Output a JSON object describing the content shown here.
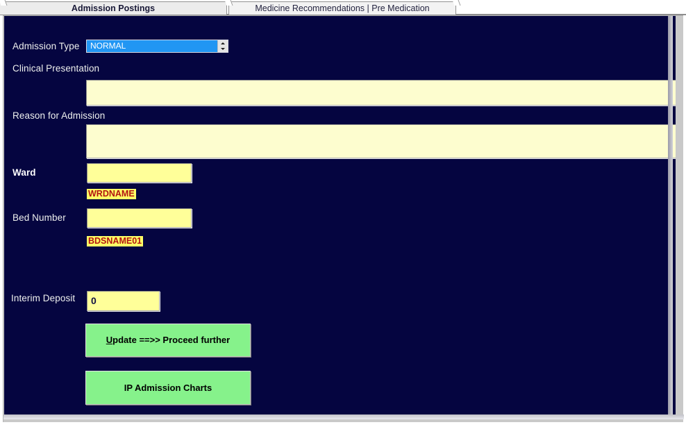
{
  "window": {
    "title": "Admission Postings",
    "background_color": "#050540",
    "accent_color": "#2196f3",
    "button_color": "#86f28b",
    "field_color": "#ffff99",
    "textarea_color": "#fdfdcf",
    "tag_text_color": "#b31412"
  },
  "tabs": [
    {
      "label": "Admission Postings",
      "active": true
    },
    {
      "label": "Medicine Recommendations | Pre Medication",
      "active": false
    }
  ],
  "form": {
    "admission_type": {
      "label": "Admission Type",
      "value": "NORMAL",
      "options": [
        "NORMAL"
      ],
      "spinner_up": "up-arrow-icon",
      "spinner_down": "down-arrow-icon"
    },
    "clinical_presentation": {
      "label": "Clinical Presentation",
      "value": "",
      "placeholder": ""
    },
    "reason_for_admission": {
      "label": "Reason for Admission",
      "value": "",
      "placeholder": ""
    },
    "ward": {
      "label": "Ward",
      "value": "",
      "placeholder": "",
      "tag": "WRDNAME"
    },
    "bed_number": {
      "label": "Bed Number",
      "value": "",
      "placeholder": "",
      "tag": "BDSNAME01"
    },
    "interim_deposit": {
      "label": "Interim Deposit",
      "value": "0",
      "placeholder": ""
    }
  },
  "actions": {
    "update": {
      "accel": "U",
      "rest": "pdate ==>> Proceed further",
      "full_label": "Update ==>> Proceed further"
    },
    "charts": {
      "label": "IP Admission Charts"
    }
  }
}
